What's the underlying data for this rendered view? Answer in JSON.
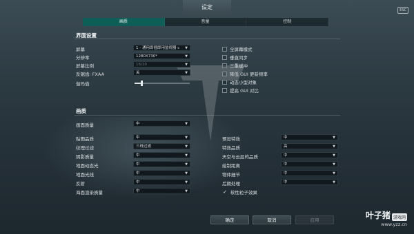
{
  "window": {
    "title": "设定",
    "esc_label": "ESC"
  },
  "tabs": [
    {
      "label": "画质"
    },
    {
      "label": "音量"
    },
    {
      "label": "控制"
    }
  ],
  "interface": {
    "title": "界面设置",
    "screen_label": "屏幕",
    "screen_value": "1 - 通用即插即用监视器 c",
    "resolution_label": "分辨率",
    "resolution_value": "1280X730*",
    "ratio_label": "屏幕比例",
    "ratio_value": "16/10",
    "aa_label": "反锯齿: FXAA",
    "aa_value": "关",
    "gamma_label": "伽玛值",
    "gamma_level": 0.12,
    "checkboxes": [
      {
        "label": "全屏幕模式",
        "checked": false
      },
      {
        "label": "垂直同步",
        "checked": false
      },
      {
        "label": "三重缓冲",
        "checked": false
      },
      {
        "label": "降低 GUI 更新频率",
        "checked": false
      },
      {
        "label": "动态小型对象",
        "checked": false
      },
      {
        "label": "提高 GUI 对比",
        "checked": false
      }
    ]
  },
  "quality": {
    "title": "画质",
    "preset_label": "画面质量",
    "preset_value": "中",
    "left": [
      {
        "label": "贴图品质",
        "value": "中"
      },
      {
        "label": "纹理过滤",
        "value": "三线过滤"
      },
      {
        "label": "阴影质量",
        "value": "中"
      },
      {
        "label": "地面动态光",
        "value": "中"
      },
      {
        "label": "地面光线",
        "value": "中"
      },
      {
        "label": "反射",
        "value": "中"
      },
      {
        "label": "海面渲染质量",
        "value": "中"
      }
    ],
    "right": [
      {
        "label": "预设特效",
        "value": "中"
      },
      {
        "label": "特效品质",
        "value": "高"
      },
      {
        "label": "天空与云层的品质",
        "value": "中"
      },
      {
        "label": "绘制距离",
        "value": "中"
      },
      {
        "label": "物体细节",
        "value": "中"
      },
      {
        "label": "后期处理",
        "value": "中"
      }
    ],
    "soft_particles_label": "软性粒子效果",
    "soft_particles_checked": true
  },
  "buttons": {
    "ok": "确定",
    "cancel": "取消",
    "apply": "应用"
  },
  "watermark": {
    "brand": "叶子猪",
    "tag": "游戏网",
    "url": "www.yzz.cn"
  },
  "colors": {
    "active_tab": "#0f5d57",
    "panel_bg": "#12191e"
  }
}
